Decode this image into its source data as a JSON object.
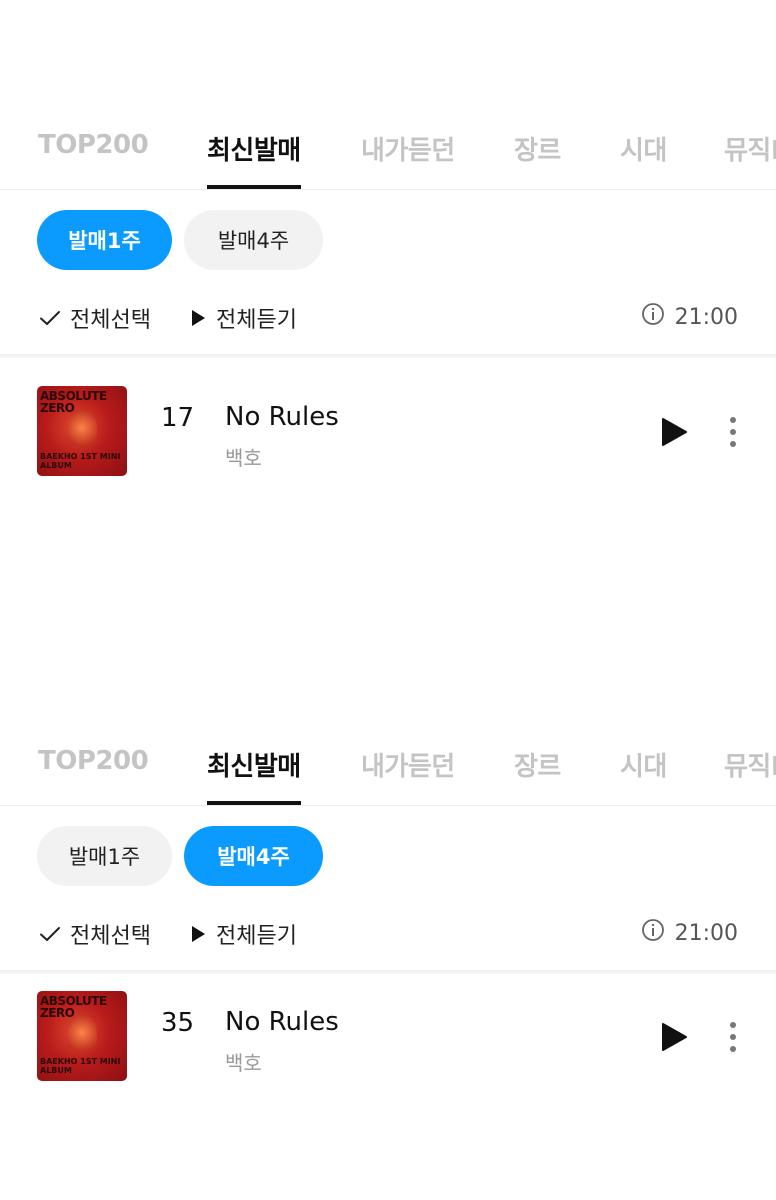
{
  "panels": [
    {
      "tabs": [
        "TOP200",
        "최신발매",
        "내가듣던",
        "장르",
        "시대",
        "뮤직PD"
      ],
      "active_tab": 1,
      "chips": [
        "발매1주",
        "발매4주"
      ],
      "active_chip": 0,
      "select_all_label": "전체선택",
      "play_all_label": "전체듣기",
      "updated_time": "21:00",
      "track": {
        "rank": "17",
        "title": "No Rules",
        "artist": "백호",
        "cover_text_top": "ABSOLUTE ZERO",
        "cover_text_bottom": "BAEKHO 1ST MINI ALBUM"
      }
    },
    {
      "tabs": [
        "TOP200",
        "최신발매",
        "내가듣던",
        "장르",
        "시대",
        "뮤직PD"
      ],
      "active_tab": 1,
      "chips": [
        "발매1주",
        "발매4주"
      ],
      "active_chip": 1,
      "select_all_label": "전체선택",
      "play_all_label": "전체듣기",
      "updated_time": "21:00",
      "track": {
        "rank": "35",
        "title": "No Rules",
        "artist": "백호",
        "cover_text_top": "ABSOLUTE ZERO",
        "cover_text_bottom": "BAEKHO 1ST MINI ALBUM"
      }
    }
  ],
  "icons": {
    "check": "check-icon",
    "play_all": "play-icon",
    "info": "info-icon",
    "play": "play-icon",
    "more": "more-vertical-icon"
  },
  "colors": {
    "accent": "#0b9bff",
    "chip_inactive": "#f2f2f2",
    "tab_inactive": "#c4c4c4",
    "artist_gray": "#999999"
  }
}
